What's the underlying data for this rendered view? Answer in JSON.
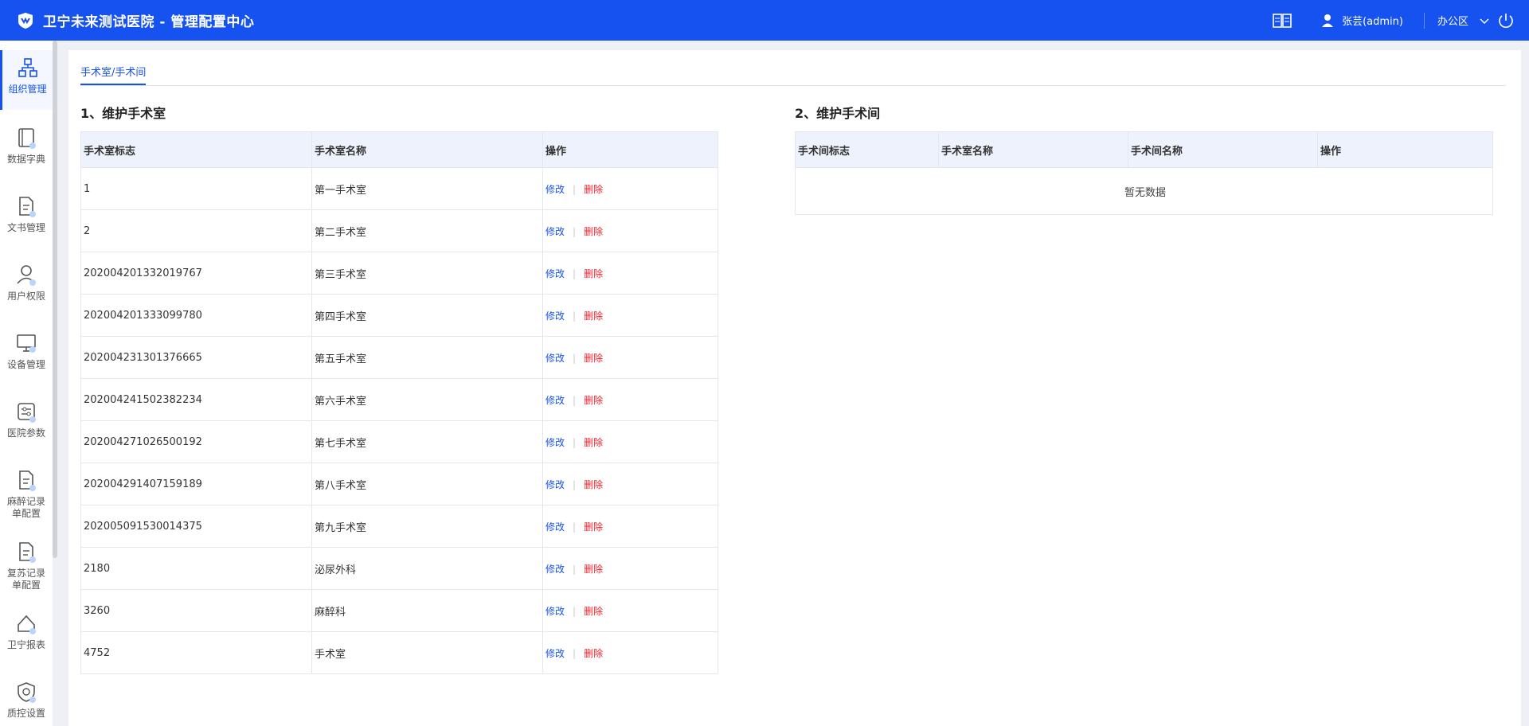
{
  "header": {
    "title": "卫宁未来测试医院 - 管理配置中心",
    "user": "张芸(admin)",
    "area": "办公区"
  },
  "sidebar": {
    "items": [
      {
        "label": "组织管理",
        "icon": "org-icon"
      },
      {
        "label": "数据字典",
        "icon": "book-icon"
      },
      {
        "label": "文书管理",
        "icon": "document-icon"
      },
      {
        "label": "用户权限",
        "icon": "user-icon"
      },
      {
        "label": "设备管理",
        "icon": "monitor-icon"
      },
      {
        "label": "医院参数",
        "icon": "settings-panel-icon"
      },
      {
        "label": "麻醉记录单配置",
        "icon": "document-icon"
      },
      {
        "label": "复苏记录单配置",
        "icon": "document-icon"
      },
      {
        "label": "卫宁报表",
        "icon": "report-icon"
      },
      {
        "label": "质控设置",
        "icon": "shield-icon"
      }
    ]
  },
  "tab": {
    "label": "手术室/手术间"
  },
  "section1": {
    "title": "1、维护手术室",
    "columns": [
      "手术室标志",
      "手术室名称",
      "操作"
    ],
    "edit_label": "修改",
    "sep": "|",
    "delete_label": "删除",
    "rows": [
      {
        "id": "1",
        "name": "第一手术室"
      },
      {
        "id": "2",
        "name": "第二手术室"
      },
      {
        "id": "202004201332019767",
        "name": "第三手术室"
      },
      {
        "id": "202004201333099780",
        "name": "第四手术室"
      },
      {
        "id": "202004231301376665",
        "name": "第五手术室"
      },
      {
        "id": "202004241502382234",
        "name": "第六手术室"
      },
      {
        "id": "202004271026500192",
        "name": "第七手术室"
      },
      {
        "id": "202004291407159189",
        "name": "第八手术室"
      },
      {
        "id": "202005091530014375",
        "name": "第九手术室"
      },
      {
        "id": "2180",
        "name": "泌尿外科"
      },
      {
        "id": "3260",
        "name": "麻醉科"
      },
      {
        "id": "4752",
        "name": "手术室"
      }
    ]
  },
  "section2": {
    "title": "2、维护手术间",
    "columns": [
      "手术间标志",
      "手术室名称",
      "手术间名称",
      "操作"
    ],
    "empty_text": "暂无数据"
  },
  "colors": {
    "primary": "#1652f0",
    "danger": "#f5222d",
    "header_bg": "#edf2fc"
  }
}
